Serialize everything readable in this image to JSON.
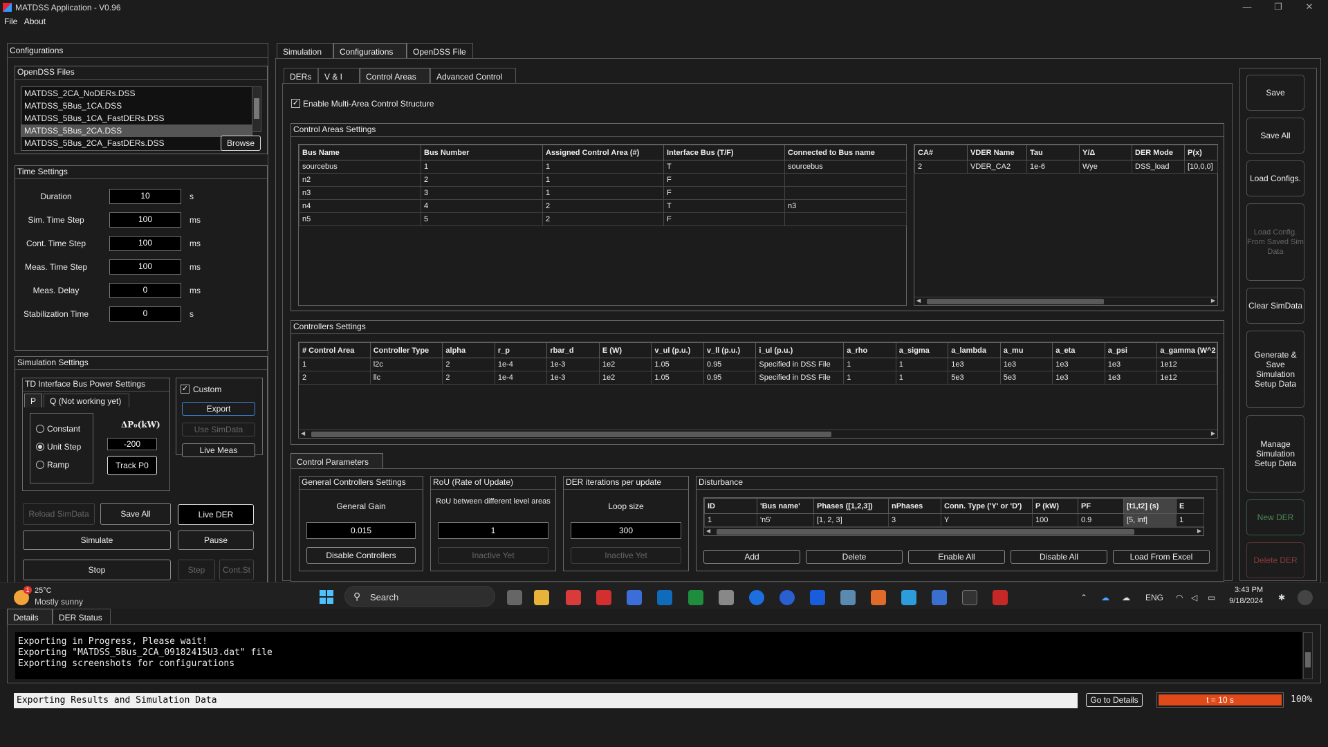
{
  "window": {
    "title": "MATDSS Application - V0.96",
    "minimize": "—",
    "restore": "❐",
    "close": "✕"
  },
  "menu": [
    "File",
    "About"
  ],
  "configurations": {
    "title": "Configurations",
    "opendss": {
      "title": "OpenDSS Files",
      "files": [
        "MATDSS_2CA_NoDERs.DSS",
        "MATDSS_5Bus_1CA.DSS",
        "MATDSS_5Bus_1CA_FastDERs.DSS",
        "MATDSS_5Bus_2CA.DSS",
        "MATDSS_5Bus_2CA_FastDERs.DSS"
      ],
      "selected_index": 3,
      "browse": "Browse"
    },
    "time": {
      "title": "Time Settings",
      "rows": [
        {
          "label": "Duration",
          "value": "10",
          "unit": "s"
        },
        {
          "label": "Sim. Time Step",
          "value": "100",
          "unit": "ms"
        },
        {
          "label": "Cont. Time Step",
          "value": "100",
          "unit": "ms"
        },
        {
          "label": "Meas. Time Step",
          "value": "100",
          "unit": "ms"
        },
        {
          "label": "Meas. Delay",
          "value": "0",
          "unit": "ms"
        },
        {
          "label": "Stabilization Time",
          "value": "0",
          "unit": "s"
        }
      ]
    },
    "sim": {
      "title": "Simulation Settings",
      "td_title": "TD Interface Bus Power Settings",
      "tab_p": "P",
      "tab_q": "Q (Not working yet)",
      "radios": [
        "Constant",
        "Unit Step",
        "Ramp"
      ],
      "radio_selected": 1,
      "delta_label": "ΔP₀(kW)",
      "delta_value": "-200",
      "track": "Track P0",
      "custom_label": "Custom",
      "custom_checked": true,
      "export": "Export",
      "use_simdata": "Use SimData",
      "live_meas": "Live Meas"
    },
    "buttons": {
      "reload": "Reload SimData",
      "save_all": "Save All",
      "live_der": "Live DER",
      "simulate": "Simulate",
      "pause": "Pause",
      "stop": "Stop",
      "step": "Step",
      "cont": "Cont.St"
    }
  },
  "main_tabs": [
    "Simulation",
    "Configurations",
    "OpenDSS File"
  ],
  "sub_tabs": [
    "DERs",
    "V & I",
    "Control Areas",
    "Advanced Control"
  ],
  "enable_multi": "Enable Multi-Area Control Structure",
  "ca_settings": {
    "title": "Control Areas Settings",
    "headers": [
      "Bus Name",
      "Bus Number",
      "Assigned Control Area (#)",
      "Interface Bus (T/F)",
      "Connected to Bus name"
    ],
    "rows": [
      [
        "sourcebus",
        "1",
        "1",
        "T",
        "sourcebus"
      ],
      [
        "n2",
        "2",
        "1",
        "F",
        ""
      ],
      [
        "n3",
        "3",
        "1",
        "F",
        ""
      ],
      [
        "n4",
        "4",
        "2",
        "T",
        "n3"
      ],
      [
        "n5",
        "5",
        "2",
        "F",
        ""
      ]
    ],
    "vder_headers": [
      "CA#",
      "VDER Name",
      "Tau",
      "Y/Δ",
      "DER Mode",
      "P(x)"
    ],
    "vder_rows": [
      [
        "2",
        "VDER_CA2",
        "1e-6",
        "Wye",
        "DSS_load",
        "[10,0,0]"
      ]
    ]
  },
  "controllers": {
    "title": "Controllers Settings",
    "headers": [
      "# Control Area",
      "Controller Type",
      "alpha",
      "r_p",
      "rbar_d",
      "E (W)",
      "v_ul (p.u.)",
      "v_ll (p.u.)",
      "i_ul (p.u.)",
      "a_rho",
      "a_sigma",
      "a_lambda",
      "a_mu",
      "a_eta",
      "a_psi",
      "a_gamma (W^2"
    ],
    "rows": [
      [
        "1",
        "l2c",
        "2",
        "1e-4",
        "1e-3",
        "1e2",
        "1.05",
        "0.95",
        "Specified in DSS File",
        "1",
        "1",
        "1e3",
        "1e3",
        "1e3",
        "1e3",
        "1e12"
      ],
      [
        "2",
        "llc",
        "2",
        "1e-4",
        "1e-3",
        "1e2",
        "1.05",
        "0.95",
        "Specified in DSS File",
        "1",
        "1",
        "5e3",
        "5e3",
        "1e3",
        "1e3",
        "1e12"
      ]
    ]
  },
  "control_params": {
    "tab": "Control Parameters",
    "general": {
      "title": "General Controllers Settings",
      "label": "General Gain",
      "value": "0.015",
      "button": "Disable Controllers"
    },
    "rou": {
      "title": "RoU (Rate of Update)",
      "label": "RoU between different level areas",
      "value": "1",
      "button": "Inactive Yet"
    },
    "der_iter": {
      "title": "DER iterations per update",
      "label": "Loop size",
      "value": "300",
      "button": "Inactive Yet"
    },
    "disturbance": {
      "title": "Disturbance",
      "headers": [
        "ID",
        "'Bus name'",
        "Phases ([1,2,3])",
        "nPhases",
        "Conn. Type ('Y' or 'D')",
        "P (kW)",
        "PF",
        "[t1,t2] (s)",
        "E"
      ],
      "rows": [
        [
          "1",
          "'n5'",
          "[1, 2, 3]",
          "3",
          "Y",
          "100",
          "0.9",
          "[5, inf]",
          "1"
        ]
      ],
      "buttons": [
        "Add",
        "Delete",
        "Enable All",
        "Disable All",
        "Load From Excel"
      ]
    }
  },
  "side_buttons": [
    "Save",
    "Save All",
    "Load Configs.",
    "Load Config. From Saved Sim Data",
    "Clear SimData",
    "Generate & Save Simulation Setup Data",
    "Manage Simulation Setup Data",
    "New DER",
    "Delete DER"
  ],
  "details": {
    "tabs": [
      "Details",
      "DER Status"
    ],
    "log": [
      "Exporting in Progress, Please wait!",
      "Exporting \"MATDSS_5Bus_2CA_09182415U3.dat\" file",
      "Exporting screenshots for configurations"
    ]
  },
  "status": {
    "text": "Exporting Results and Simulation Data",
    "goto": "Go to Details",
    "progress_label": "t = 10 s",
    "progress": 1.0,
    "percent": "100%",
    "progress_color": "#e04a1a"
  },
  "taskbar": {
    "weather_temp": "25°C",
    "weather_desc": "Mostly sunny",
    "weather_badge": "1",
    "search": "Search",
    "lang": "ENG",
    "time": "3:43 PM",
    "date": "9/18/2024"
  }
}
